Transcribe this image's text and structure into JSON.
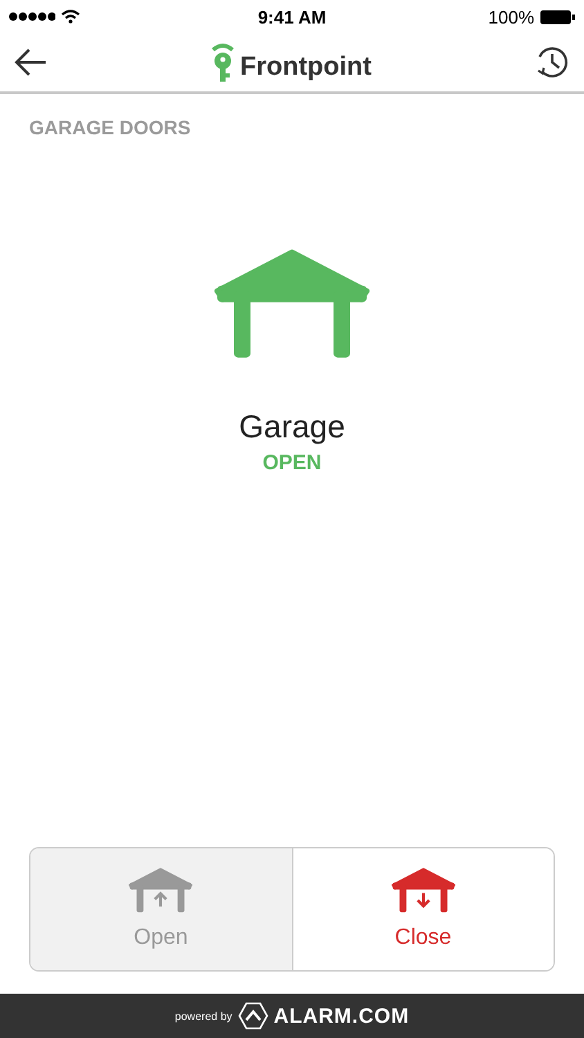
{
  "status_bar": {
    "time": "9:41 AM",
    "battery": "100%"
  },
  "nav": {
    "brand": "Frontpoint"
  },
  "section": {
    "title": "GARAGE DOORS"
  },
  "door": {
    "name": "Garage",
    "status": "OPEN",
    "open": true
  },
  "actions": [
    {
      "kind": "open",
      "label": "Open",
      "disabled": true
    },
    {
      "kind": "close",
      "label": "Close",
      "disabled": false
    }
  ],
  "footer": {
    "powered": "powered by",
    "brand": "ALARM.COM"
  }
}
